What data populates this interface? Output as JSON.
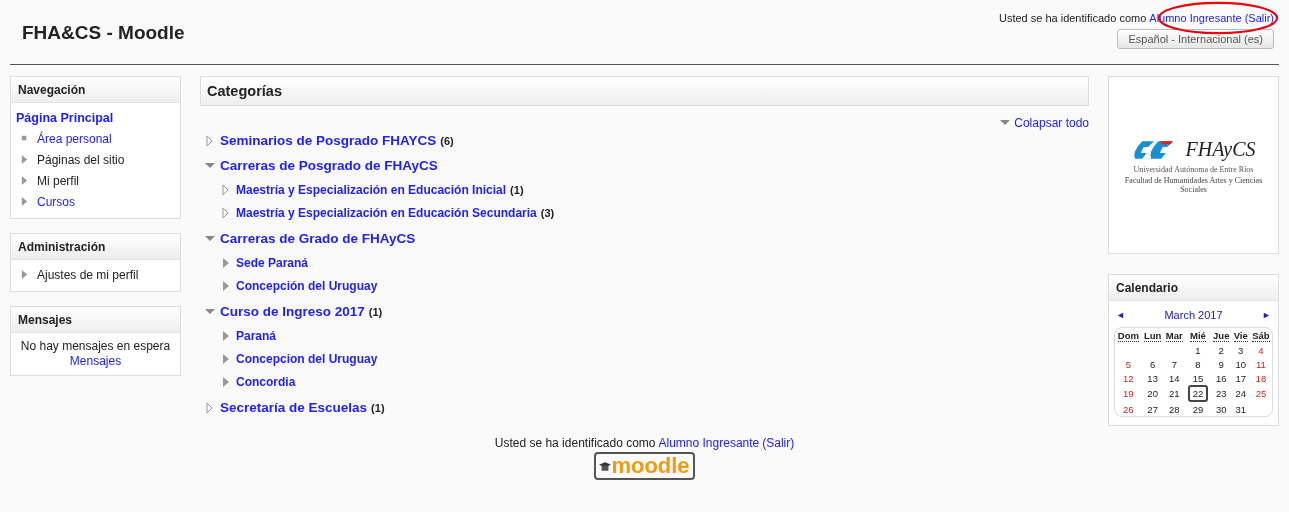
{
  "header": {
    "site_title": "FHA&CS - Moodle",
    "login_prefix": "Usted se ha identificado como",
    "user_link": "Alumno Ingresante",
    "logout_link": "(Salir)",
    "language": "Español - Internacional (es)",
    "annotation": true
  },
  "left_blocks": [
    {
      "title": "Navegación",
      "items": [
        {
          "kind": "heading",
          "label": "Página Principal",
          "link": true
        },
        {
          "kind": "bullet",
          "label": "Área personal",
          "link": true
        },
        {
          "kind": "branch",
          "label": "Páginas del sitio",
          "link": false
        },
        {
          "kind": "branch",
          "label": "Mi perfil",
          "link": false
        },
        {
          "kind": "branch",
          "label": "Cursos",
          "link": true
        }
      ]
    },
    {
      "title": "Administración",
      "items": [
        {
          "kind": "branch",
          "label": "Ajustes de mi perfil",
          "link": false
        }
      ]
    },
    {
      "title": "Mensajes",
      "message": "No hay mensajes en espera",
      "link": "Mensajes"
    }
  ],
  "main": {
    "title": "Categorías",
    "collapse_all": "Colapsar todo",
    "categories": [
      {
        "name": "Seminarios de Posgrado FHAYCS",
        "count": "(6)",
        "kind": "expandable",
        "expanded": false
      },
      {
        "name": "Carreras de Posgrado de FHAyCS",
        "kind": "expandable",
        "expanded": true,
        "children": [
          {
            "name": "Maestría y Especialización en Educación Inicial",
            "count": "(1)",
            "kind": "expandable",
            "expanded": false
          },
          {
            "name": "Maestría y Especialización en Educación Secundaria",
            "count": "(3)",
            "kind": "expandable",
            "expanded": false
          }
        ]
      },
      {
        "name": "Carreras de Grado de FHAyCS",
        "kind": "expandable",
        "expanded": true,
        "children": [
          {
            "name": "Sede Paraná",
            "kind": "leaf"
          },
          {
            "name": "Concepción del Uruguay",
            "kind": "leaf"
          }
        ]
      },
      {
        "name": "Curso de Ingreso 2017",
        "count": "(1)",
        "kind": "expandable",
        "expanded": true,
        "children": [
          {
            "name": "Paraná",
            "kind": "leaf"
          },
          {
            "name": "Concepcion del Uruguay",
            "kind": "leaf"
          },
          {
            "name": "Concordia",
            "kind": "leaf"
          }
        ]
      },
      {
        "name": "Secretaría de Escuelas",
        "count": "(1)",
        "kind": "expandable",
        "expanded": false
      }
    ]
  },
  "logo_block": {
    "name": "FHAyCS",
    "university": "Universidad Autónoma de Entre Ríos",
    "faculty": "Facultad de Humanidades Artes y Ciencias Sociales"
  },
  "calendar": {
    "title": "Calendario",
    "prev": "◄",
    "month": "March 2017",
    "next": "►",
    "weekdays": [
      "Dom",
      "Lun",
      "Mar",
      "Mié",
      "Jue",
      "Vie",
      "Sáb"
    ],
    "weeks": [
      [
        {
          "day": "1",
          "weekend": false,
          "today": false
        },
        {
          "day": "2",
          "weekend": false,
          "today": false
        },
        {
          "day": "3",
          "weekend": false,
          "today": false
        },
        {
          "day": "4",
          "weekend": true,
          "today": false
        }
      ],
      [
        {
          "day": "5",
          "weekend": true,
          "today": false
        },
        {
          "day": "6",
          "weekend": false,
          "today": false
        },
        {
          "day": "7",
          "weekend": false,
          "today": false
        },
        {
          "day": "8",
          "weekend": false,
          "today": false
        },
        {
          "day": "9",
          "weekend": false,
          "today": false
        },
        {
          "day": "10",
          "weekend": false,
          "today": false
        },
        {
          "day": "11",
          "weekend": true,
          "today": false
        }
      ],
      [
        {
          "day": "12",
          "weekend": true,
          "today": false
        },
        {
          "day": "13",
          "weekend": false,
          "today": false
        },
        {
          "day": "14",
          "weekend": false,
          "today": false
        },
        {
          "day": "15",
          "weekend": false,
          "today": false
        },
        {
          "day": "16",
          "weekend": false,
          "today": false
        },
        {
          "day": "17",
          "weekend": false,
          "today": false
        },
        {
          "day": "18",
          "weekend": true,
          "today": false
        }
      ],
      [
        {
          "day": "19",
          "weekend": true,
          "today": false
        },
        {
          "day": "20",
          "weekend": false,
          "today": false
        },
        {
          "day": "21",
          "weekend": false,
          "today": false
        },
        {
          "day": "22",
          "weekend": false,
          "today": true
        },
        {
          "day": "23",
          "weekend": false,
          "today": false
        },
        {
          "day": "24",
          "weekend": false,
          "today": false
        },
        {
          "day": "25",
          "weekend": true,
          "today": false
        }
      ],
      [
        {
          "day": "26",
          "weekend": true,
          "today": false
        },
        {
          "day": "27",
          "weekend": false,
          "today": false
        },
        {
          "day": "28",
          "weekend": false,
          "today": false
        },
        {
          "day": "29",
          "weekend": false,
          "today": false
        },
        {
          "day": "30",
          "weekend": false,
          "today": false
        },
        {
          "day": "31",
          "weekend": false,
          "today": false
        }
      ]
    ]
  },
  "footer": {
    "login_prefix": "Usted se ha identificado como",
    "user_link": "Alumno Ingresante",
    "logout_link": "(Salir)",
    "logo": "moodle"
  }
}
